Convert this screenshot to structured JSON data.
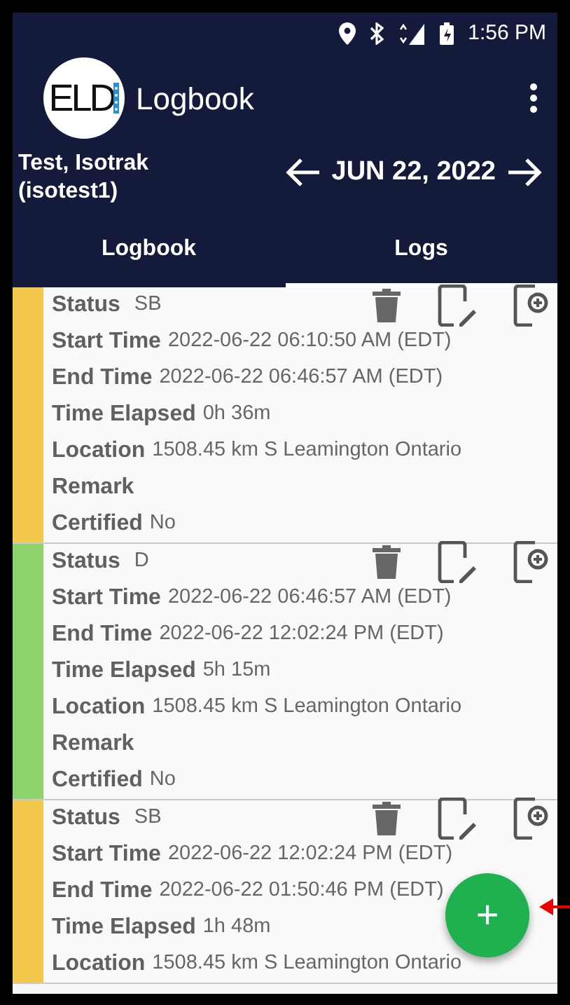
{
  "status_bar": {
    "time": "1:56 PM"
  },
  "app_bar": {
    "logo": "ELD",
    "title": "Logbook"
  },
  "driver": {
    "name": "Test, Isotrak",
    "username": "(isotest1)"
  },
  "date": "JUN 22, 2022",
  "tabs": [
    {
      "label": "Logbook",
      "selected": false
    },
    {
      "label": "Logs",
      "selected": true
    }
  ],
  "entries": [
    {
      "color": "#f2c94c",
      "fields": [
        {
          "label": "Status",
          "value": "SB"
        },
        {
          "label": "Start Time",
          "value": "2022-06-22 06:10:50 AM (EDT)"
        },
        {
          "label": "End Time",
          "value": "2022-06-22 06:46:57 AM (EDT)"
        },
        {
          "label": "Time Elapsed",
          "value": "0h 36m"
        },
        {
          "label": "Location",
          "value": "1508.45 km S Leamington Ontario"
        },
        {
          "label": "Remark"
        },
        {
          "label": "Certified",
          "value": "No"
        }
      ]
    },
    {
      "color": "#8fd46a",
      "fields": [
        {
          "label": "Status",
          "value": "D"
        },
        {
          "label": "Start Time",
          "value": "2022-06-22 06:46:57 AM (EDT)"
        },
        {
          "label": "End Time",
          "value": "2022-06-22 12:02:24 PM (EDT)"
        },
        {
          "label": "Time Elapsed",
          "value": "5h 15m"
        },
        {
          "label": "Location",
          "value": "1508.45 km S Leamington Ontario"
        },
        {
          "label": "Remark"
        },
        {
          "label": "Certified",
          "value": "No"
        }
      ]
    },
    {
      "color": "#f2c94c",
      "fields": [
        {
          "label": "Status",
          "value": "SB"
        },
        {
          "label": "Start Time",
          "value": "2022-06-22 12:02:24 PM (EDT)"
        },
        {
          "label": "End Time",
          "value": "2022-06-22 01:50:46 PM (EDT)"
        },
        {
          "label": "Time Elapsed",
          "value": "1h 48m"
        },
        {
          "label": "Location",
          "value": "1508.45 km S Leamington Ontario"
        }
      ]
    }
  ],
  "fab": {
    "symbol": "+"
  }
}
